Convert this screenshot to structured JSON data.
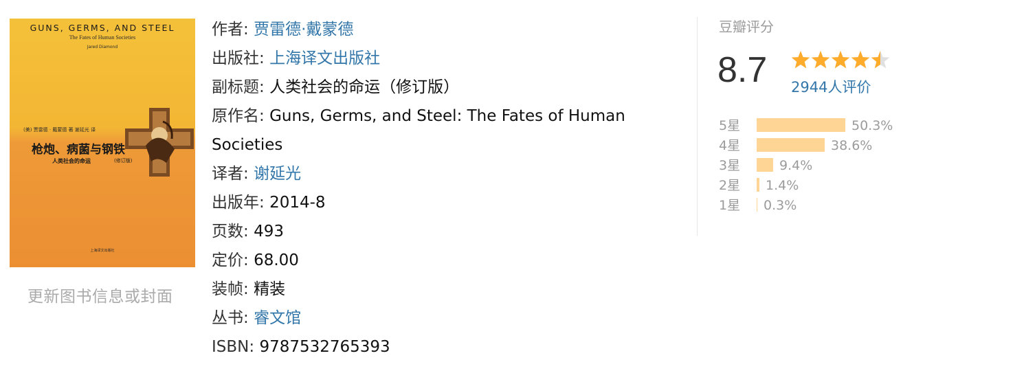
{
  "cover": {
    "title_en": "GUNS, GERMS, AND STEEL",
    "subtitle_en": "The Fates of Human Societies",
    "author_en": "Jared Diamond",
    "credits_cn": "(美) 贾雷德 · 戴蒙德  著   谢延光  译",
    "title_cn": "枪炮、病菌与钢铁",
    "subtitle_cn": "人类社会的命运",
    "edition_cn": "(修订版)",
    "publisher_cn": "上海译文出版社"
  },
  "update_link": "更新图书信息或封面",
  "info": {
    "author_label": "作者:",
    "author_value": "贾雷德·戴蒙德",
    "publisher_label": "出版社:",
    "publisher_value": "上海译文出版社",
    "subtitle_label": "副标题:",
    "subtitle_value": "人类社会的命运（修订版）",
    "original_label": "原作名:",
    "original_value": "Guns, Germs, and Steel: The Fates of Human Societies",
    "translator_label": "译者:",
    "translator_value": "谢延光",
    "year_label": "出版年:",
    "year_value": "2014-8",
    "pages_label": "页数:",
    "pages_value": "493",
    "price_label": "定价:",
    "price_value": "68.00",
    "binding_label": "装帧:",
    "binding_value": "精装",
    "series_label": "丛书:",
    "series_value": "睿文馆",
    "isbn_label": "ISBN:",
    "isbn_value": "9787532765393"
  },
  "rating": {
    "title": "豆瓣评分",
    "score": "8.7",
    "stars": 4.5,
    "votes": "2944人评价",
    "distribution": [
      {
        "label": "5星",
        "pct_text": "50.3%",
        "pct": 50.3
      },
      {
        "label": "4星",
        "pct_text": "38.6%",
        "pct": 38.6
      },
      {
        "label": "3星",
        "pct_text": "9.4%",
        "pct": 9.4
      },
      {
        "label": "2星",
        "pct_text": "1.4%",
        "pct": 1.4
      },
      {
        "label": "1星",
        "pct_text": "0.3%",
        "pct": 0.3
      }
    ],
    "colors": {
      "star": "#ffac2d",
      "star_empty": "#e0e0e0",
      "bar": "#ffd596",
      "link": "#3377aa"
    }
  }
}
